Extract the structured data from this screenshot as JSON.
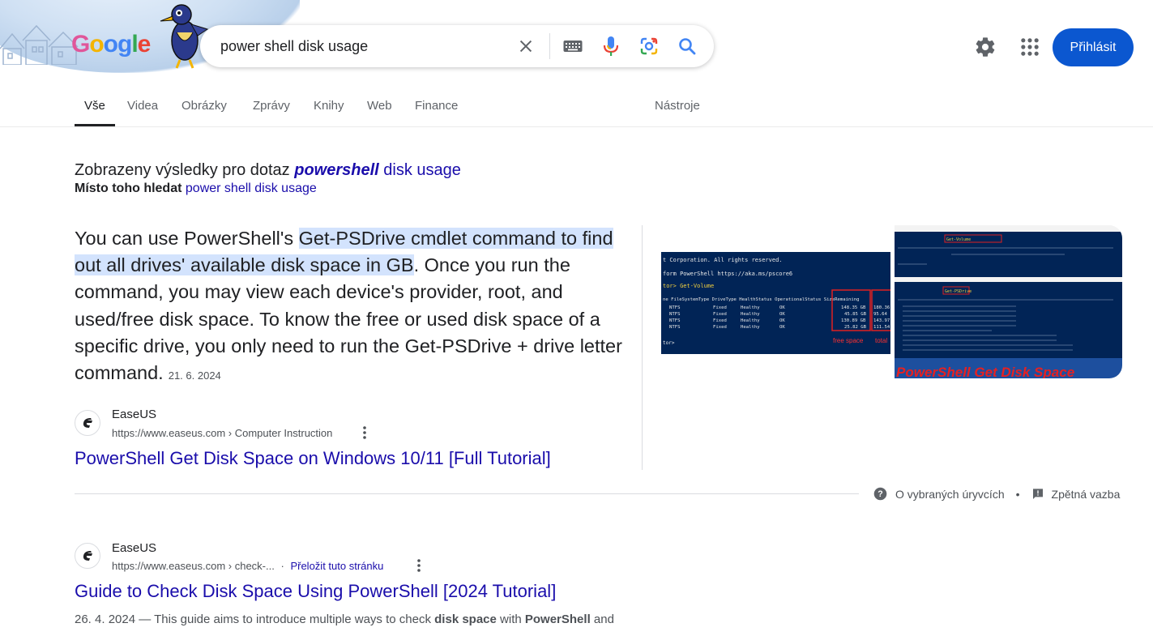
{
  "doodle": {
    "logo_letters": [
      "G",
      "o",
      "o",
      "g",
      "l",
      "e"
    ],
    "logo_colors": [
      "#e0569a",
      "#f4b400",
      "#4285f4",
      "#4285f4",
      "#34a853",
      "#ea4335"
    ]
  },
  "search": {
    "query": "power shell disk usage"
  },
  "header": {
    "signin_label": "Přihlásit",
    "accent": "#0b57d0"
  },
  "tabs": [
    {
      "label": "Vše",
      "active": true
    },
    {
      "label": "Videa"
    },
    {
      "label": "Obrázky"
    },
    {
      "label": "Zprávy"
    },
    {
      "label": "Knihy"
    },
    {
      "label": "Web"
    },
    {
      "label": "Finance"
    }
  ],
  "tools_label": "Nástroje",
  "spelling": {
    "shown_prefix": "Zobrazeny výsledky pro dotaz",
    "shown_bold": "powershell",
    "shown_rest": "disk usage",
    "instead_prefix": "Místo toho hledat",
    "instead_link": "power shell disk usage"
  },
  "featured": {
    "text_before": "You can use PowerShell's ",
    "highlight": "Get-PSDrive cmdlet command to find out all drives' available disk space in GB",
    "text_after": ". Once you run the command, you may view each device's provider, root, and used/free disk space. To know the free or used disk space of a specific drive, you only need to run the Get-PSDrive + drive letter command.",
    "date": "21. 6. 2024",
    "source_name": "EaseUS",
    "source_url": "https://www.easeus.com › Computer Instruction",
    "title": "PowerShell Get Disk Space on Windows 10/11 [Full Tutorial]",
    "image1": {
      "lines": [
        "t Corporation. All rights reserved.",
        "form PowerShell https://aka.ms/pscore6",
        "tor> Get-Volume"
      ],
      "header": "ne FileSystemType DriveType HealthStatus OperationalStatus SizeRemaining",
      "rows": [
        [
          "NTFS",
          "Fixed",
          "Healthy",
          "OK",
          "148.35 GB",
          "180.36"
        ],
        [
          "NTFS",
          "Fixed",
          "Healthy",
          "OK",
          "45.85 GB",
          "95.64"
        ],
        [
          "NTFS",
          "Fixed",
          "Healthy",
          "OK",
          "130.89 GB",
          "143.97"
        ],
        [
          "NTFS",
          "Fixed",
          "Healthy",
          "OK",
          "25.82 GB",
          "111.54"
        ]
      ],
      "free_label": "free space",
      "total_label": "total",
      "prompt": "tor>"
    },
    "image2": {
      "banner": "PowerShell Get Disk Space",
      "cmd1": "Get-Volume",
      "cmd2": "Get-PSDrive"
    }
  },
  "about": {
    "snippets_label": "O vybraných úryvcích",
    "feedback_label": "Zpětná vazba"
  },
  "result2": {
    "source_name": "EaseUS",
    "source_url": "https://www.easeus.com › check-...",
    "separator": "·",
    "translate_label": "Přeložit tuto stránku",
    "title": "Guide to Check Disk Space Using PowerShell [2024 Tutorial]",
    "desc_date": "26. 4. 2024",
    "desc_a": " — This guide aims to introduce multiple ways to check ",
    "desc_b1": "disk space",
    "desc_c": " with ",
    "desc_b2": "PowerShell",
    "desc_d": " and"
  }
}
